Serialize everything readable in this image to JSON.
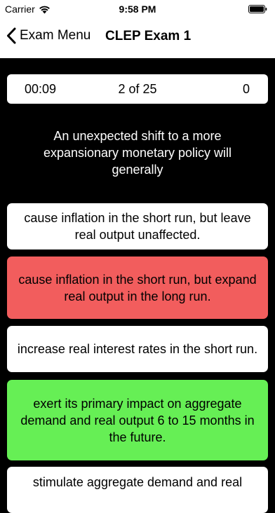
{
  "status_bar": {
    "carrier": "Carrier",
    "time": "9:58 PM",
    "icons": [
      "wifi-icon",
      "battery-icon"
    ]
  },
  "nav": {
    "back_label": "Exam Menu",
    "title": "CLEP Exam 1",
    "back_icon": "chevron-left-icon"
  },
  "status_card": {
    "timer": "00:09",
    "progress": "2 of 25",
    "score": "0"
  },
  "question": "An unexpected shift to a more expansionary monetary policy will generally",
  "answers": [
    {
      "text": "cause inflation in the short run, but leave real output unaffected.",
      "state": "neutral",
      "color": "#ffffff"
    },
    {
      "text": "cause inflation in the short run, but expand real output in the long run.",
      "state": "incorrect",
      "color": "#f25d5d"
    },
    {
      "text": "increase real interest rates in the short run.",
      "state": "neutral",
      "color": "#ffffff"
    },
    {
      "text": "exert its primary impact on aggregate demand and real output 6 to 15 months in the future.",
      "state": "correct",
      "color": "#66ef55"
    },
    {
      "text": "stimulate aggregate demand and real",
      "state": "neutral",
      "color": "#ffffff"
    }
  ]
}
